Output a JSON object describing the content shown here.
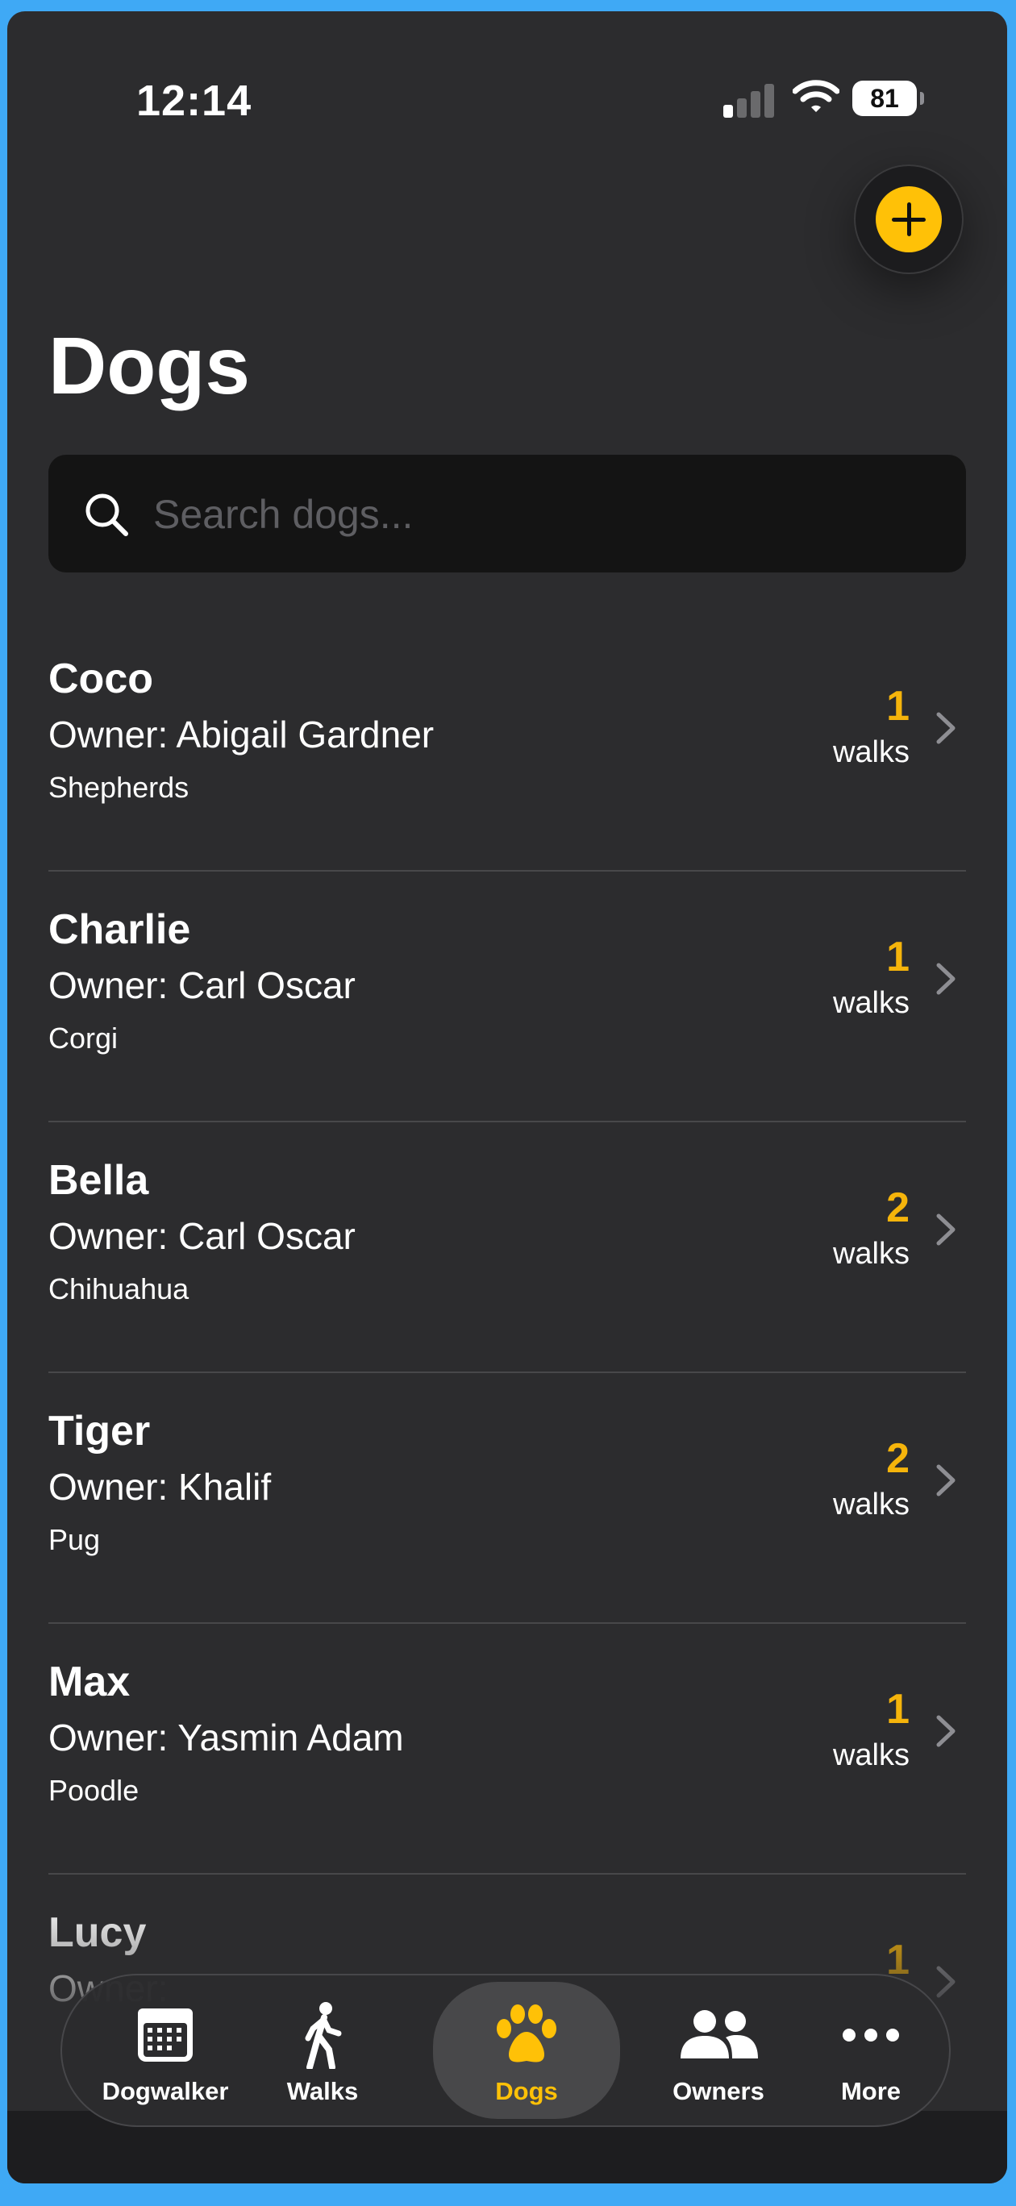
{
  "status_bar": {
    "time": "12:14",
    "battery": "81"
  },
  "header": {
    "title": "Dogs"
  },
  "search": {
    "placeholder": "Search dogs..."
  },
  "dogs": [
    {
      "name": "Coco",
      "owner": "Owner: Abigail Gardner",
      "breed": "Shepherds",
      "walks": "1",
      "walks_label": "walks"
    },
    {
      "name": "Charlie",
      "owner": "Owner: Carl Oscar",
      "breed": "Corgi",
      "walks": "1",
      "walks_label": "walks"
    },
    {
      "name": "Bella",
      "owner": "Owner: Carl Oscar",
      "breed": "Chihuahua",
      "walks": "2",
      "walks_label": "walks"
    },
    {
      "name": "Tiger",
      "owner": "Owner: Khalif",
      "breed": "Pug",
      "walks": "2",
      "walks_label": "walks"
    },
    {
      "name": "Max",
      "owner": "Owner: Yasmin Adam",
      "breed": "Poodle",
      "walks": "1",
      "walks_label": "walks"
    },
    {
      "name": "Lucy",
      "owner": "Owner: ",
      "breed": "",
      "walks": "1",
      "walks_label": ""
    }
  ],
  "tab_bar": {
    "items": [
      {
        "label": "Dogwalker",
        "icon": "calendar-icon"
      },
      {
        "label": "Walks",
        "icon": "walking-person-icon"
      },
      {
        "label": "Dogs",
        "icon": "paw-icon",
        "active": true
      },
      {
        "label": "Owners",
        "icon": "people-icon"
      },
      {
        "label": "More",
        "icon": "ellipsis-icon"
      }
    ]
  },
  "colors": {
    "accent": "#FFC107",
    "walk_count": "#F5B40B",
    "background": "#2C2C2E",
    "frame": "#3FA9F5"
  }
}
